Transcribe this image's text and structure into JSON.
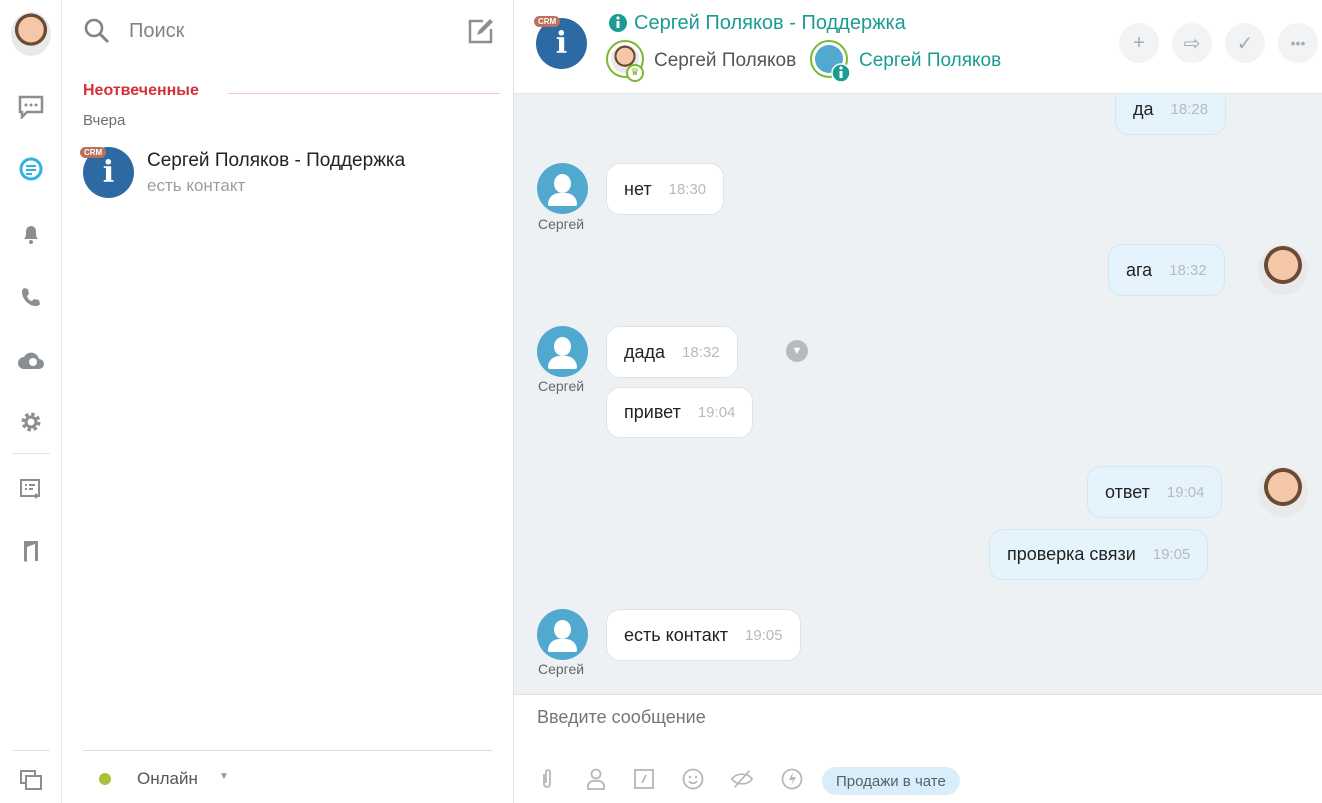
{
  "rail": {
    "items": [
      "chat-icon",
      "open-lines-icon",
      "bell-icon",
      "phone-icon",
      "cloud-icon",
      "gear-icon",
      "crm-form-icon",
      "door-icon",
      "windows-icon"
    ]
  },
  "list": {
    "search_placeholder": "Поиск",
    "section_label": "Неотвеченные",
    "day_label": "Вчера",
    "items": [
      {
        "title": "Сергей Поляков - Поддержка",
        "subtitle": "есть контакт",
        "badge": "CRM"
      }
    ],
    "status": "Онлайн"
  },
  "header": {
    "badge": "CRM",
    "title": "Сергей Поляков - Поддержка",
    "operator": "Сергей Поляков",
    "client": "Сергей Поляков"
  },
  "messages": [
    {
      "side": "out",
      "text": "да",
      "time": "18:28"
    },
    {
      "side": "in",
      "author": "Сергей",
      "text": "нет",
      "time": "18:30"
    },
    {
      "side": "out",
      "text": "ага",
      "time": "18:32"
    },
    {
      "side": "in",
      "author": "Сергей",
      "text": "дада",
      "time": "18:32"
    },
    {
      "side": "in",
      "text": "привет",
      "time": "19:04"
    },
    {
      "side": "out",
      "text": "ответ",
      "time": "19:04"
    },
    {
      "side": "out",
      "text": "проверка связи",
      "time": "19:05"
    },
    {
      "side": "in",
      "author": "Сергей",
      "text": "есть контакт",
      "time": "19:05"
    }
  ],
  "input": {
    "placeholder": "Введите сообщение",
    "sales_button": "Продажи в чате"
  },
  "colors": {
    "accent": "#1a9c92",
    "unanswered": "#d6303a",
    "outgoing": "#e5f4fc",
    "online": "#a9c23c"
  }
}
